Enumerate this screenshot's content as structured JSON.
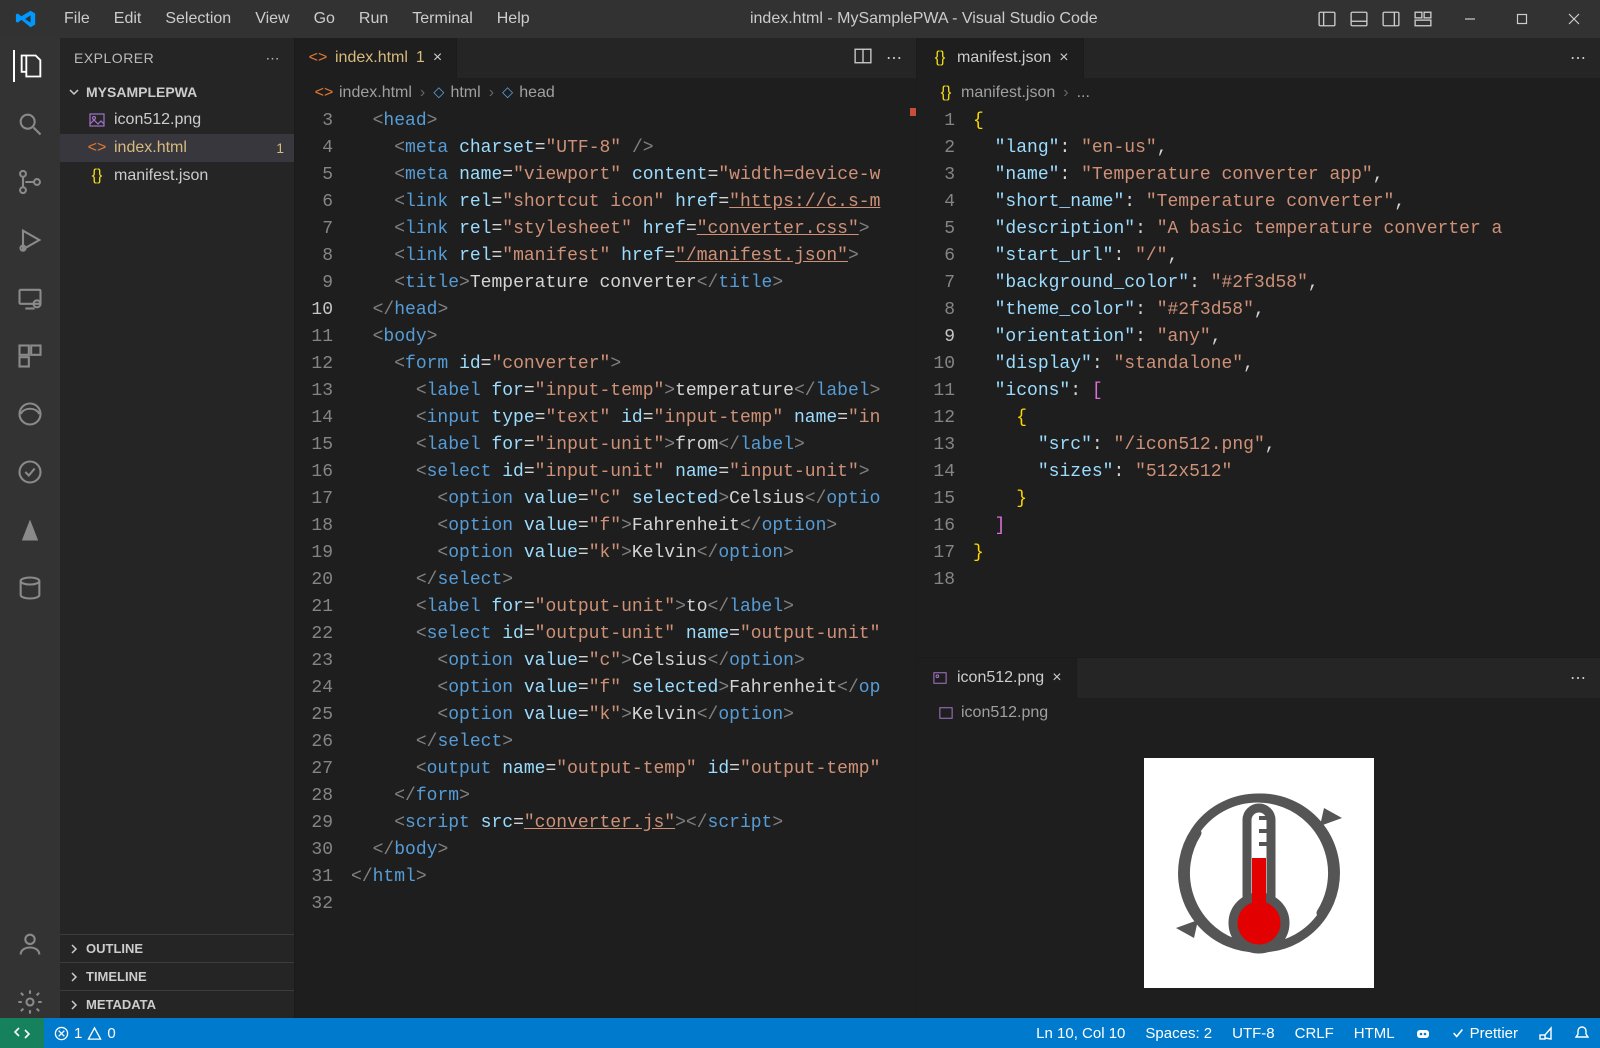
{
  "titlebar": {
    "menus": [
      "File",
      "Edit",
      "Selection",
      "View",
      "Go",
      "Run",
      "Terminal",
      "Help"
    ],
    "title": "index.html - MySamplePWA - Visual Studio Code"
  },
  "sidebar": {
    "header": "EXPLORER",
    "project": "MYSAMPLEPWA",
    "files": [
      {
        "name": "icon512.png",
        "icon": "image"
      },
      {
        "name": "index.html",
        "icon": "html",
        "modified": true,
        "badge": "1",
        "active": true
      },
      {
        "name": "manifest.json",
        "icon": "json"
      }
    ],
    "sections": [
      "OUTLINE",
      "TIMELINE",
      "METADATA"
    ]
  },
  "tabs_left": {
    "name": "index.html",
    "modified": true,
    "badge": "1"
  },
  "tabs_right_top": {
    "name": "manifest.json"
  },
  "tabs_right_bot": {
    "name": "icon512.png"
  },
  "breadcrumb_left": [
    "index.html",
    "html",
    "head"
  ],
  "breadcrumb_right_top": [
    "manifest.json",
    "..."
  ],
  "breadcrumb_right_bot": [
    "icon512.png"
  ],
  "code_left": {
    "start": 3,
    "current": 10,
    "lines": [
      "  <head>",
      "    <meta charset=\"UTF-8\" />",
      "    <meta name=\"viewport\" content=\"width=device-w",
      "    <link rel=\"shortcut icon\" href=\"https://c.s-m",
      "    <link rel=\"stylesheet\" href=\"converter.css\">",
      "    <link rel=\"manifest\" href=\"/manifest.json\">",
      "    <title>Temperature converter</title>",
      "  </head>",
      "  <body>",
      "    <form id=\"converter\">",
      "      <label for=\"input-temp\">temperature</label>",
      "      <input type=\"text\" id=\"input-temp\" name=\"in",
      "      <label for=\"input-unit\">from</label>",
      "      <select id=\"input-unit\" name=\"input-unit\">",
      "        <option value=\"c\" selected>Celsius</optio",
      "        <option value=\"f\">Fahrenheit</option>",
      "        <option value=\"k\">Kelvin</option>",
      "      </select>",
      "      <label for=\"output-unit\">to</label>",
      "      <select id=\"output-unit\" name=\"output-unit\"",
      "        <option value=\"c\">Celsius</option>",
      "        <option value=\"f\" selected>Fahrenheit</op",
      "        <option value=\"k\">Kelvin</option>",
      "      </select>",
      "      <output name=\"output-temp\" id=\"output-temp\"",
      "    </form>",
      "    <script src=\"converter.js\"></script>",
      "  </body>",
      "</html>",
      ""
    ]
  },
  "code_right": {
    "start": 1,
    "current": 9,
    "lines": [
      "{",
      "  \"lang\": \"en-us\",",
      "  \"name\": \"Temperature converter app\",",
      "  \"short_name\": \"Temperature converter\",",
      "  \"description\": \"A basic temperature converter a",
      "  \"start_url\": \"/\",",
      "  \"background_color\": \"#2f3d58\",",
      "  \"theme_color\": \"#2f3d58\",",
      "  \"orientation\": \"any\",",
      "  \"display\": \"standalone\",",
      "  \"icons\": [",
      "    {",
      "      \"src\": \"/icon512.png\",",
      "      \"sizes\": \"512x512\"",
      "    }",
      "  ]",
      "}",
      ""
    ]
  },
  "statusbar": {
    "errors": "1",
    "warnings": "0",
    "pos": "Ln 10, Col 10",
    "spaces": "Spaces: 2",
    "encoding": "UTF-8",
    "eol": "CRLF",
    "lang": "HTML",
    "prettier": "Prettier"
  }
}
